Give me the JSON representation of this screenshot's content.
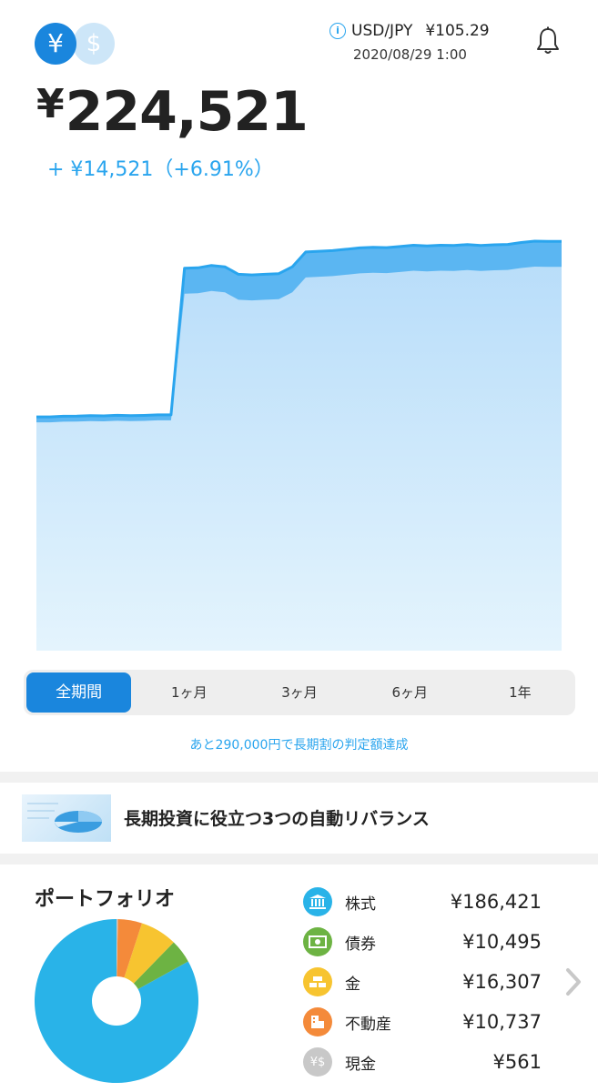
{
  "header": {
    "currency_yen_symbol": "¥",
    "currency_usd_symbol": "$",
    "fx_pair": "USD/JPY",
    "fx_rate": "¥105.29",
    "fx_datetime": "2020/08/29 1:00"
  },
  "balance": {
    "yen_mark": "¥",
    "total": "224,521",
    "gain": "+ ¥14,521（+6.91%）"
  },
  "chart_data": {
    "type": "area",
    "series": [
      {
        "values": [
          100000,
          100000,
          100500,
          100600,
          101000,
          100800,
          101200,
          100900,
          101100,
          101500,
          101500,
          210000,
          210300,
          212000,
          211000,
          205500,
          205000,
          205500,
          206000,
          211000,
          222000,
          222500,
          223000,
          224000,
          225000,
          225500,
          225200,
          226000,
          227000,
          226500,
          227000,
          226800,
          227500,
          226800,
          227300,
          227600,
          229000,
          230000,
          229800,
          229800
        ]
      }
    ],
    "accent": "#2aa5ee"
  },
  "periods": {
    "tabs": [
      "全期間",
      "1ヶ月",
      "3ヶ月",
      "6ヶ月",
      "1年"
    ],
    "selected": "全期間"
  },
  "threshold_text": "あと290,000円で長期割の判定額達成",
  "banner": {
    "title": "長期投資に役立つ3つの自動リバランス"
  },
  "portfolio": {
    "title": "ポートフォリオ",
    "items": [
      {
        "label": "株式",
        "value": "¥186,421",
        "amount": 186421,
        "color": "#29b3e8",
        "icon": "bank-icon"
      },
      {
        "label": "債券",
        "value": "¥10,495",
        "amount": 10495,
        "color": "#6db343",
        "icon": "bond-icon"
      },
      {
        "label": "金",
        "value": "¥16,307",
        "amount": 16307,
        "color": "#f7c430",
        "icon": "gold-bars-icon"
      },
      {
        "label": "不動産",
        "value": "¥10,737",
        "amount": 10737,
        "color": "#f48a3a",
        "icon": "building-icon"
      },
      {
        "label": "現金",
        "value": "¥561",
        "amount": 561,
        "color": "#c8c8c8",
        "icon": "cash-icon"
      }
    ]
  }
}
